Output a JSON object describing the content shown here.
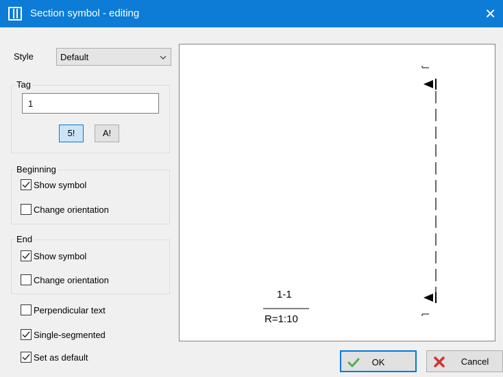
{
  "window": {
    "title": "Section symbol - editing"
  },
  "style": {
    "label": "Style",
    "selected": "Default"
  },
  "tag": {
    "group_label": "Tag",
    "value": "1",
    "btn_number": "5!",
    "btn_letter": "A!"
  },
  "beginning": {
    "group_label": "Beginning",
    "show_symbol": {
      "label": "Show symbol",
      "checked": true
    },
    "change_orientation": {
      "label": "Change orientation",
      "checked": false
    }
  },
  "end": {
    "group_label": "End",
    "show_symbol": {
      "label": "Show symbol",
      "checked": true
    },
    "change_orientation": {
      "label": "Change orientation",
      "checked": false
    }
  },
  "options": {
    "perpendicular_text": {
      "label": "Perpendicular text",
      "checked": false
    },
    "single_segmented": {
      "label": "Single-segmented",
      "checked": true
    },
    "set_as_default": {
      "label": "Set as default",
      "checked": true
    }
  },
  "preview": {
    "section_label": "1-1",
    "scale_label": "R=1:10"
  },
  "buttons": {
    "ok": "OK",
    "cancel": "Cancel"
  },
  "colors": {
    "titlebar": "#0c7cd6",
    "ok_check": "#4caf50",
    "cancel_x": "#d32f2f"
  }
}
